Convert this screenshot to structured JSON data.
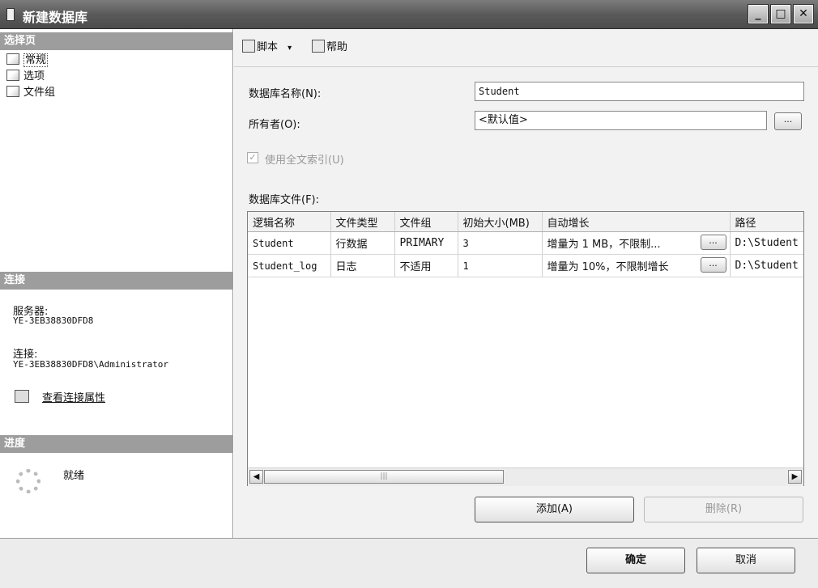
{
  "window": {
    "title": "新建数据库",
    "minimize": "_",
    "maximize": "□",
    "close": "✕"
  },
  "select_page": {
    "header": "选择页",
    "items": [
      "常规",
      "选项",
      "文件组"
    ]
  },
  "connection": {
    "header": "连接",
    "server_label": "服务器:",
    "server_value": "YE-3EB38830DFD8",
    "conn_label": "连接:",
    "conn_value": "YE-3EB38830DFD8\\Administrator",
    "view_props_link": "查看连接属性"
  },
  "progress": {
    "header": "进度",
    "status": "就绪"
  },
  "toolbar": {
    "script_label": "脚本",
    "script_arrow": "▾",
    "help_label": "帮助"
  },
  "form": {
    "db_name_label": "数据库名称(N):",
    "db_name_value": "Student",
    "owner_label": "所有者(O):",
    "owner_value": "<默认值>",
    "ellipsis": "...",
    "fulltext_label": "使用全文索引(U)",
    "fulltext_check": "✓",
    "db_files_label": "数据库文件(F):"
  },
  "files_table": {
    "columns": [
      "逻辑名称",
      "文件类型",
      "文件组",
      "初始大小(MB)",
      "自动增长",
      "路径"
    ],
    "rows": [
      [
        "Student",
        "行数据",
        "PRIMARY",
        "3",
        "增量为 1 MB，不限制...",
        "D:\\Student"
      ],
      [
        "Student_log",
        "日志",
        "不适用",
        "1",
        "增量为 10%，不限制增长",
        "D:\\Student"
      ]
    ],
    "scroll_left": "◀",
    "scroll_right": "▶",
    "scroll_grip": "|||"
  },
  "actions": {
    "add": "添加(A)",
    "remove": "删除(R)"
  },
  "footer": {
    "ok": "确定",
    "cancel": "取消"
  }
}
